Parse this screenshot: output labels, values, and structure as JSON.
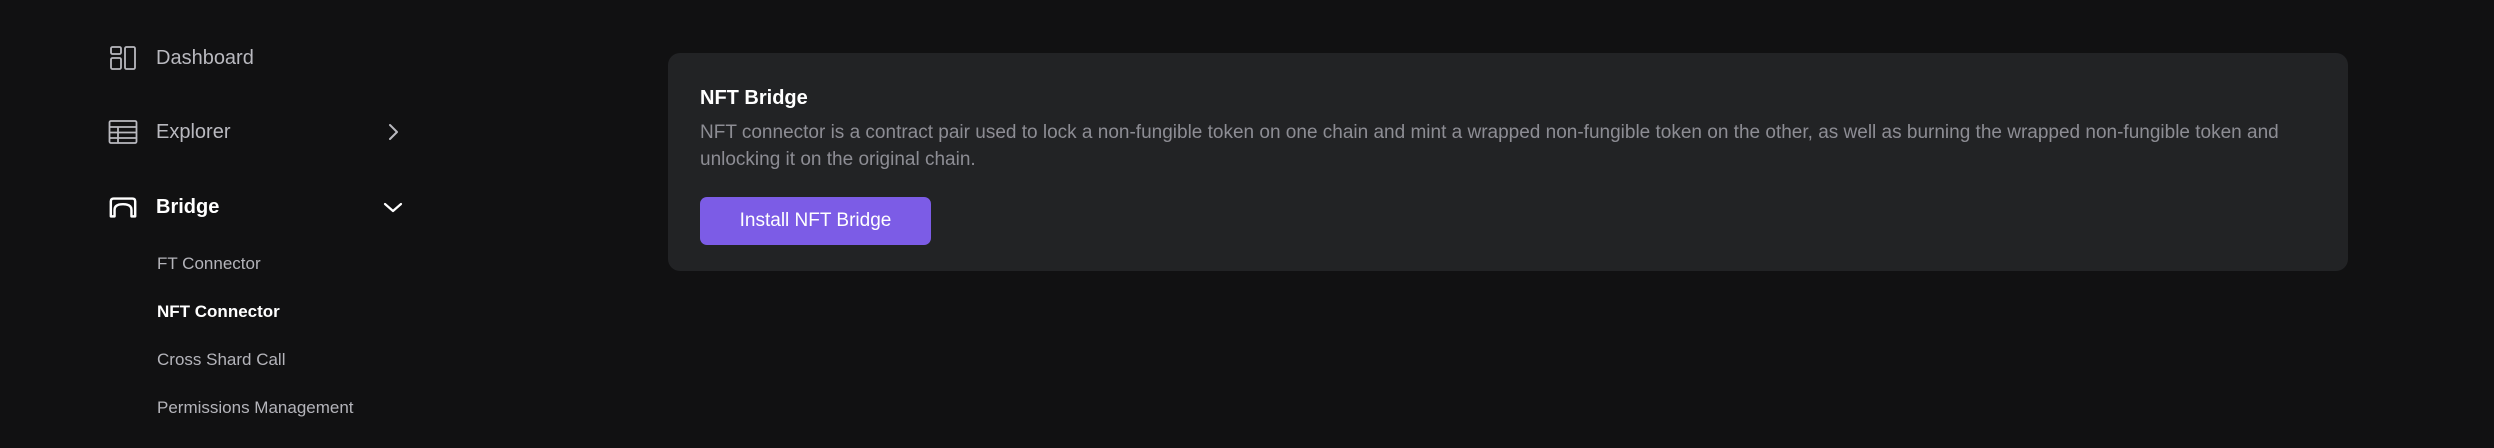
{
  "sidebar": {
    "dashboard": {
      "label": "Dashboard",
      "icon": "dashboard-icon"
    },
    "explorer": {
      "label": "Explorer",
      "icon": "table-icon"
    },
    "bridge": {
      "label": "Bridge",
      "icon": "bridge-icon",
      "expanded": true,
      "items": [
        {
          "label": "FT Connector",
          "active": false
        },
        {
          "label": "NFT Connector",
          "active": true
        },
        {
          "label": "Cross Shard Call",
          "active": false
        },
        {
          "label": "Permissions Management",
          "active": false
        }
      ]
    }
  },
  "main": {
    "card": {
      "title": "NFT Bridge",
      "description": "NFT connector is a contract pair used to lock a non-fungible token on one chain and mint a wrapped non-fungible token on the other, as well as burning the wrapped non-fungible token and unlocking it on the original chain.",
      "button_label": "Install NFT Bridge"
    }
  },
  "colors": {
    "background": "#111112",
    "card": "#222325",
    "accent": "#7c5ce6",
    "text_primary": "#ffffff",
    "text_muted": "#8d8d94"
  }
}
